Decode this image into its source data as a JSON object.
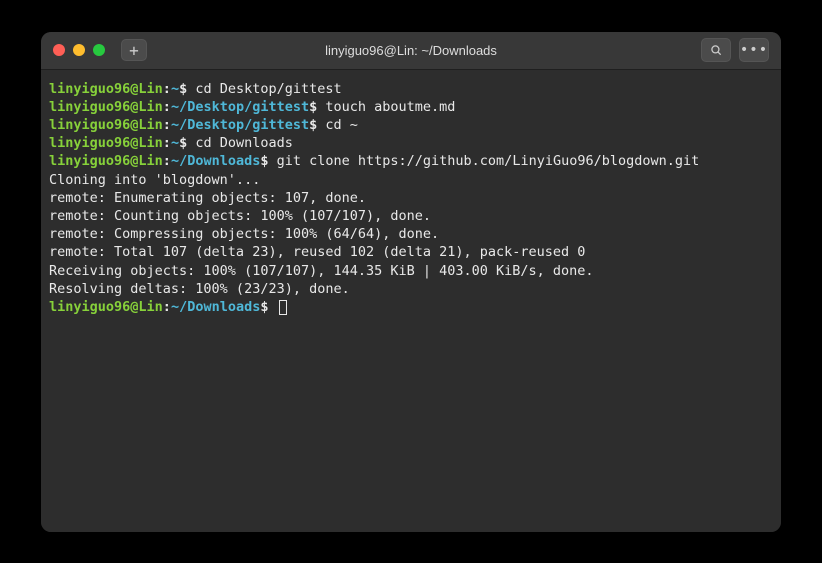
{
  "titlebar": {
    "title": "linyiguo96@Lin: ~/Downloads",
    "newtab_glyph": "+"
  },
  "prompt": {
    "user_host": "linyiguo96@Lin",
    "sep": ":",
    "dollar": "$"
  },
  "lines": {
    "l1": {
      "path": "~",
      "cmd": " cd Desktop/gittest"
    },
    "l2": {
      "path": "~/Desktop/gittest",
      "cmd": " touch aboutme.md"
    },
    "l3": {
      "path": "~/Desktop/gittest",
      "cmd": " cd ~"
    },
    "l4": {
      "path": "~",
      "cmd": " cd Downloads"
    },
    "l5": {
      "path": "~/Downloads",
      "cmd": " git clone https://github.com/LinyiGuo96/blogdown.git"
    },
    "l6": "Cloning into 'blogdown'...",
    "l7": "remote: Enumerating objects: 107, done.",
    "l8": "remote: Counting objects: 100% (107/107), done.",
    "l9": "remote: Compressing objects: 100% (64/64), done.",
    "l10": "remote: Total 107 (delta 23), reused 102 (delta 21), pack-reused 0",
    "l11": "Receiving objects: 100% (107/107), 144.35 KiB | 403.00 KiB/s, done.",
    "l12": "Resolving deltas: 100% (23/23), done.",
    "l13": {
      "path": "~/Downloads",
      "cmd": " "
    }
  }
}
